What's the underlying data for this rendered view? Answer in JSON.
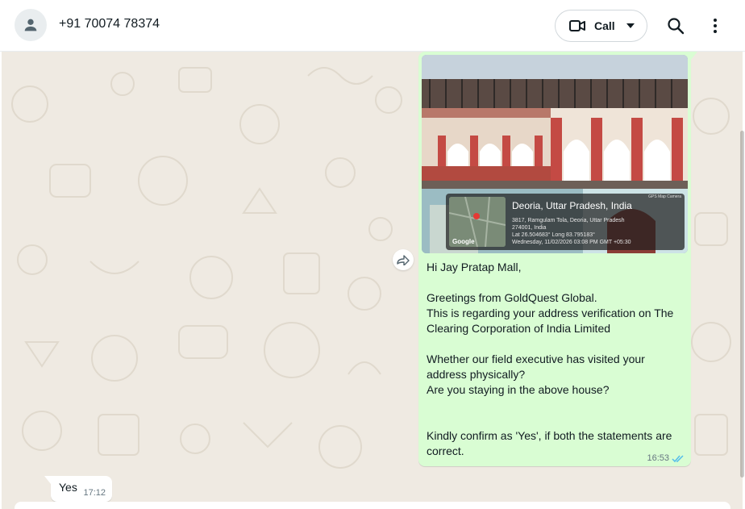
{
  "header": {
    "contact_name": "+91 70074 78374",
    "call_label": "Call",
    "icons": [
      "person-icon",
      "video-icon",
      "chevron-down-icon",
      "search-icon",
      "more-vertical-icon"
    ]
  },
  "messages": {
    "outgoing": {
      "photo_overlay": {
        "camera_label": "GPS Map Camera",
        "place": "Deoria, Uttar Pradesh, India",
        "address_line1": "3817, Ramgulam Tola, Deoria, Uttar Pradesh",
        "address_line2": "274001, India",
        "coords": "Lat 26.504683° Long 83.795183°",
        "datetime": "Wednesday, 11/02/2026 03:08 PM GMT +05:30",
        "map_brand": "Google"
      },
      "text": "Hi Jay Pratap Mall,\n\nGreetings from GoldQuest Global.\nThis is regarding your address verification on The Clearing Corporation of India Limited\n\nWhether our field executive has visited your address physically?\nAre you staying in the above house?\n\n\nKindly confirm as 'Yes', if both the statements are correct.",
      "time": "16:53",
      "status": "read"
    },
    "incoming": {
      "text": "Yes",
      "time": "17:12"
    }
  },
  "colors": {
    "chat_bg": "#efeae2",
    "outgoing_bubble": "#d9fdd3",
    "incoming_bubble": "#ffffff",
    "read_ticks": "#53bdeb"
  }
}
